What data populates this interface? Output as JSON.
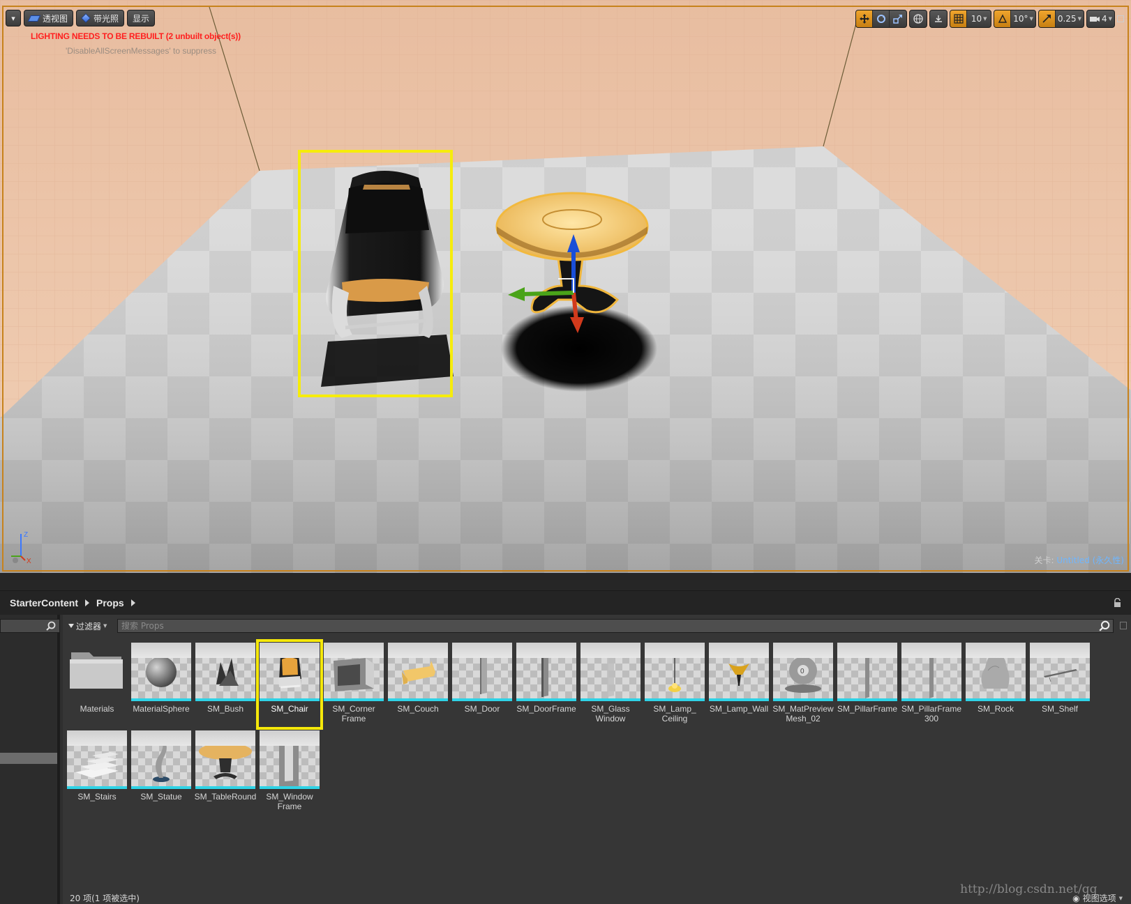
{
  "viewport": {
    "toolbar_left": {
      "perspective_label": "透视图",
      "lit_label": "带光照",
      "show_label": "显示"
    },
    "toolbar_right": {
      "grid_snap_value": "10",
      "rotation_snap_value": "10°",
      "scale_snap_value": "0.25",
      "camera_speed_value": "4"
    },
    "warning": "LIGHTING NEEDS TO BE REBUILT (2 unbuilt object(s))",
    "warning_hint": "'DisableAllScreenMessages' to suppress",
    "axis_labels": {
      "z": "Z",
      "x": "X"
    },
    "level_key": "关卡:",
    "level_value": "Untitled (永久性)"
  },
  "content_browser": {
    "breadcrumb": [
      "StarterContent",
      "Props"
    ],
    "filter_label": "过滤器",
    "search_placeholder": "搜索 Props",
    "assets": [
      {
        "name": "Materials",
        "kind": "folder"
      },
      {
        "name": "MaterialSphere",
        "kind": "sphere"
      },
      {
        "name": "SM_Bush",
        "kind": "bush"
      },
      {
        "name": "SM_Chair",
        "kind": "chair",
        "selected": true
      },
      {
        "name": "SM_Corner Frame",
        "kind": "corner"
      },
      {
        "name": "SM_Couch",
        "kind": "couch"
      },
      {
        "name": "SM_Door",
        "kind": "door"
      },
      {
        "name": "SM_DoorFrame",
        "kind": "doorframe"
      },
      {
        "name": "SM_Glass Window",
        "kind": "glass"
      },
      {
        "name": "SM_Lamp_ Ceiling",
        "kind": "lampceiling"
      },
      {
        "name": "SM_Lamp_Wall",
        "kind": "lampwall"
      },
      {
        "name": "SM_MatPreview Mesh_02",
        "kind": "matpreview"
      },
      {
        "name": "SM_PillarFrame",
        "kind": "pillar"
      },
      {
        "name": "SM_PillarFrame 300",
        "kind": "pillar"
      },
      {
        "name": "SM_Rock",
        "kind": "rock"
      },
      {
        "name": "SM_Shelf",
        "kind": "shelf"
      },
      {
        "name": "SM_Stairs",
        "kind": "stairs"
      },
      {
        "name": "SM_Statue",
        "kind": "statue"
      },
      {
        "name": "SM_TableRound",
        "kind": "table"
      },
      {
        "name": "SM_Window Frame",
        "kind": "windowframe"
      }
    ],
    "status": "20 项(1 项被选中)",
    "view_options_label": "视图选项"
  },
  "watermark": "http://blog.csdn.net/qq_"
}
